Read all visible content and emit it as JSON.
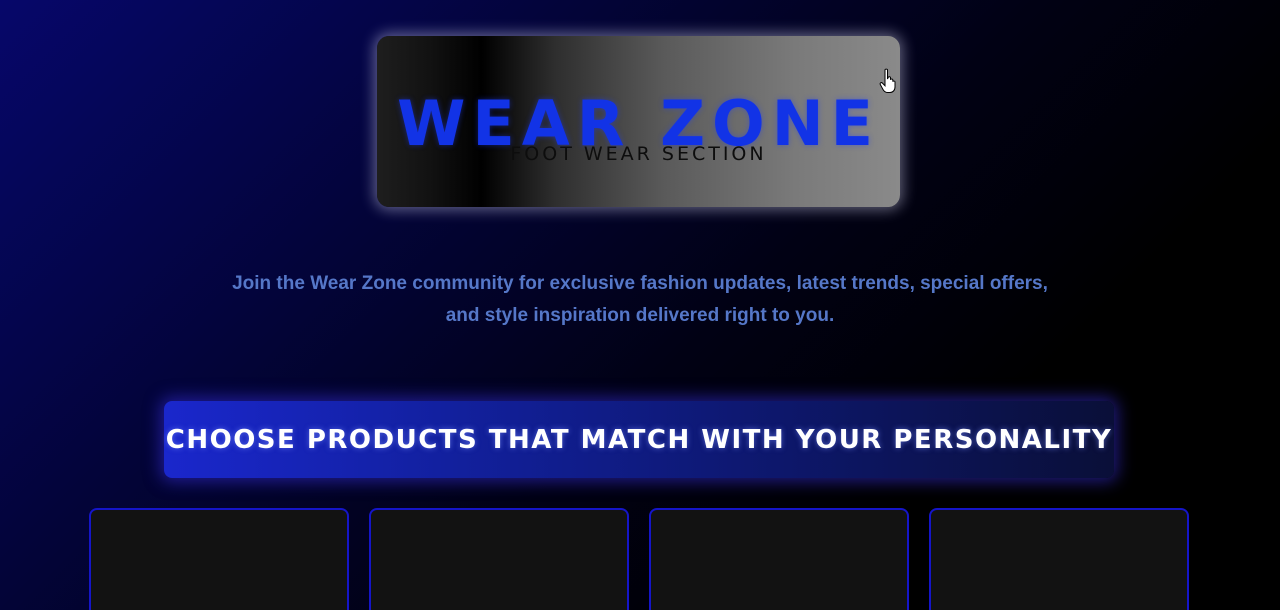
{
  "brand": {
    "title": "WEAR ZONE",
    "subtitle": "FOOT WEAR SECTION"
  },
  "tagline": "Join the Wear Zone community for exclusive fashion updates, latest trends, special offers, and style inspiration delivered right to you.",
  "banner": {
    "text": "CHOOSE PRODUCTS THAT MATCH WITH YOUR PERSONALITY"
  },
  "products": [
    {
      "label": ""
    },
    {
      "label": ""
    },
    {
      "label": ""
    },
    {
      "label": ""
    }
  ],
  "cursor": {
    "icon": "hand-pointer-icon"
  },
  "colors": {
    "accent": "#1233e6",
    "tagline": "#5577c8",
    "card_border": "#1515c8",
    "card_background": "#121212",
    "banner_start": "#1a27cc",
    "banner_end": "#0a0f38"
  }
}
